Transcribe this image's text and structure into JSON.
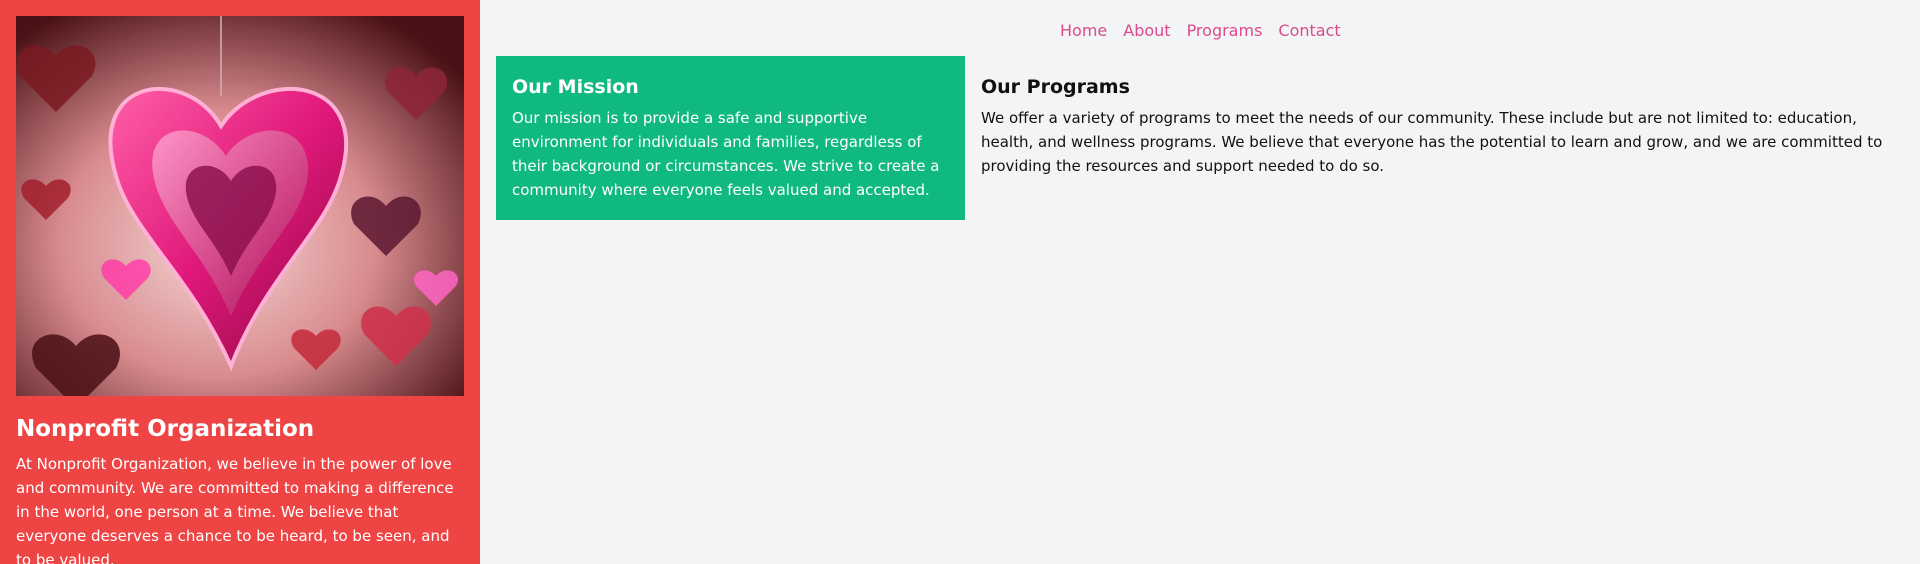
{
  "nav": {
    "items": [
      {
        "label": "Home"
      },
      {
        "label": "About"
      },
      {
        "label": "Programs"
      },
      {
        "label": "Contact"
      }
    ],
    "link_color": "#db4a8e"
  },
  "sidebar": {
    "background": "#ef4444",
    "image_icon": "hanging-heart-image",
    "title": "Nonprofit Organization",
    "text": "At Nonprofit Organization, we believe in the power of love and community. We are committed to making a difference in the world, one person at a time. We believe that everyone deserves a chance to be heard, to be seen, and to be valued."
  },
  "mission": {
    "background": "#10b981",
    "title": "Our Mission",
    "text": "Our mission is to provide a safe and supportive environment for individuals and families, regardless of their background or circumstances. We strive to create a community where everyone feels valued and accepted."
  },
  "programs": {
    "title": "Our Programs",
    "text": "We offer a variety of programs to meet the needs of our community. These include but are not limited to: education, health, and wellness programs. We believe that everyone has the potential to learn and grow, and we are committed to providing the resources and support needed to do so."
  }
}
